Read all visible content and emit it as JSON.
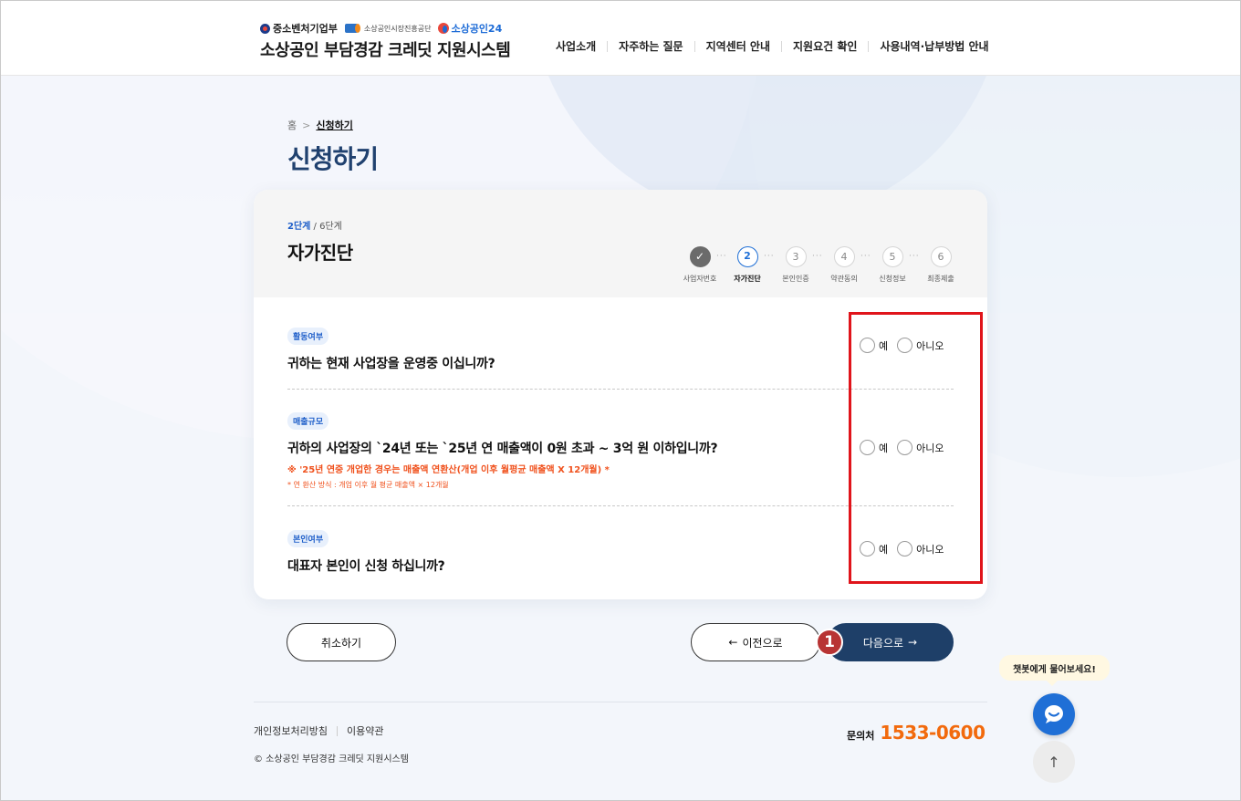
{
  "header": {
    "logo_mss": "중소벤처기업부",
    "logo_semas": "소상공인시장진흥공단",
    "logo_sbiz24": "소상공인24",
    "site_title": "소상공인 부담경감 크레딧 지원시스템",
    "nav": [
      "사업소개",
      "자주하는 질문",
      "지역센터 안내",
      "지원요건 확인",
      "사용내역·납부방법 안내"
    ]
  },
  "breadcrumb": {
    "home": "홈",
    "separator": ">",
    "current": "신청하기"
  },
  "page_title": "신청하기",
  "card": {
    "step_current": "2단계",
    "step_total": " / 6단계",
    "title": "자가진단",
    "steps": [
      {
        "number": "✓",
        "name": "사업자번호",
        "state": "done"
      },
      {
        "number": "2",
        "name": "자가진단",
        "state": "active"
      },
      {
        "number": "3",
        "name": "본인인증",
        "state": "pending"
      },
      {
        "number": "4",
        "name": "약관동의",
        "state": "pending"
      },
      {
        "number": "5",
        "name": "신청정보",
        "state": "pending"
      },
      {
        "number": "6",
        "name": "최종제출",
        "state": "pending"
      }
    ],
    "step_connector": "···",
    "questions": [
      {
        "tag": "활동여부",
        "text": "귀하는 현재 사업장을 운영중 이십니까?",
        "options": [
          "예",
          "아니오"
        ]
      },
      {
        "tag": "매출규모",
        "text": "귀하의 사업장의 `24년 또는 `25년 연 매출액이 0원 초과 ~ 3억 원 이하입니까?",
        "note1": "※ '25년 연중 개업한 경우는 매출액 연환산(개업 이후 월평균 매출액 X 12개월) *",
        "note2": "* 연 환산 방식 : 개업 이후 월 평균 매출액 × 12개월",
        "options": [
          "예",
          "아니오"
        ]
      },
      {
        "tag": "본인여부",
        "text": "대표자 본인이 신청 하십니까?",
        "options": [
          "예",
          "아니오"
        ]
      }
    ]
  },
  "buttons": {
    "cancel": "취소하기",
    "prev": "이전으로",
    "prev_arrow": "←",
    "next": "다음으로",
    "next_arrow": "→"
  },
  "annotation_badge": "1",
  "footer": {
    "links": [
      "개인정보처리방침",
      "이용약관"
    ],
    "copyright": "© 소상공인 부담경감 크레딧 지원시스템",
    "contact_label": "문의처",
    "contact_number": "1533-0600"
  },
  "chatbot": {
    "bubble": "챗봇에게 물어보세요!",
    "top_arrow": "↑"
  },
  "colors": {
    "brand_navy": "#1e3f68",
    "title_blue": "#20416f",
    "accent_blue": "#1f6fd6",
    "warning_orange": "#f0521e",
    "contact_orange": "#f26a0d",
    "highlight_red": "#e0141b",
    "badge_red": "#b83434"
  }
}
